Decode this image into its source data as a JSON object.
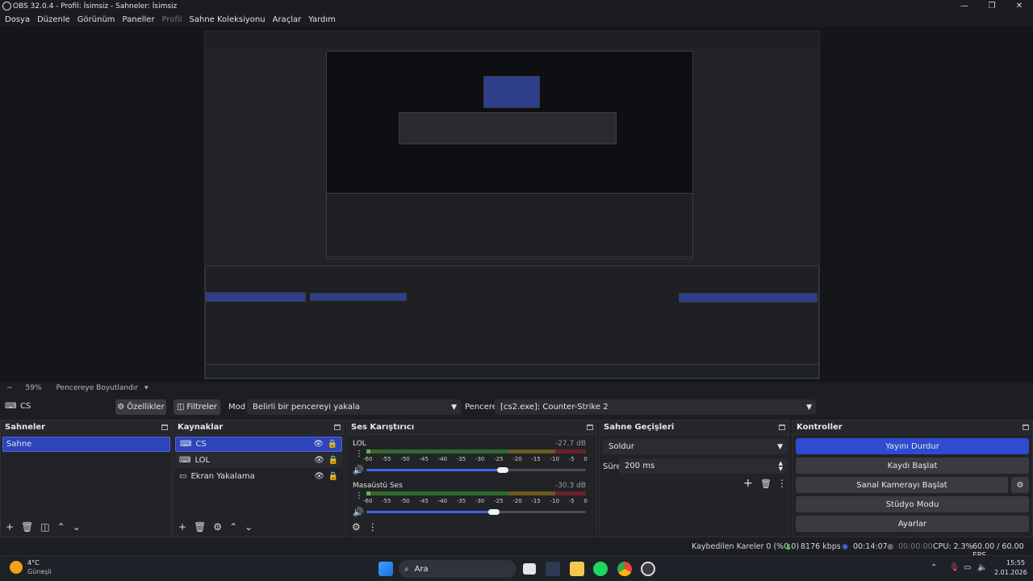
{
  "window": {
    "title": "OBS 32.0.4 - Profil: İsimsiz - Sahneler: İsimsiz",
    "controls": [
      "—",
      "❐",
      "✕"
    ]
  },
  "menu": [
    "Dosya",
    "Düzenle",
    "Görünüm",
    "Paneller",
    "Profil",
    "Sahne Koleksiyonu",
    "Araçlar",
    "Yardım"
  ],
  "zoom": {
    "minus": "−",
    "percent": "59%",
    "fit_label": "Pencereye Boyutlandır"
  },
  "source_toolbar": {
    "source_name": "CS",
    "properties": "Özellikler",
    "filters": "Filtreler",
    "mode_label": "Mod",
    "mode_value": "Belirli bir pencereyi yakala",
    "window_label": "Pencere",
    "window_value": "[cs2.exe]: Counter-Strike 2"
  },
  "scenes": {
    "title": "Sahneler",
    "items": [
      "Sahne"
    ]
  },
  "sources": {
    "title": "Kaynaklar",
    "items": [
      "CS",
      "LOL",
      "Ekran Yakalama"
    ]
  },
  "mixer": {
    "title": "Ses Karıştırıcı",
    "ticks": [
      "-60",
      "-55",
      "-50",
      "-45",
      "-40",
      "-35",
      "-30",
      "-25",
      "-20",
      "-15",
      "-10",
      "-5",
      "0"
    ],
    "channels": [
      {
        "name": "LOL",
        "db": "-27.7 dB",
        "level": 0.62
      },
      {
        "name": "Masaüstü Ses",
        "db": "-30.3 dB",
        "level": 0.58
      }
    ]
  },
  "transitions": {
    "title": "Sahne Geçişleri",
    "type": "Soldur",
    "duration_label": "Süre",
    "duration_value": "200 ms"
  },
  "controls": {
    "title": "Kontroller",
    "stop_stream": "Yayını Durdur",
    "start_record": "Kaydı Başlat",
    "virtual_cam": "Sanal Kamerayı Başlat",
    "studio_mode": "Stüdyo Modu",
    "settings": "Ayarlar"
  },
  "status": {
    "dropped": "Kaybedilen Kareler 0 (%0.0)",
    "bitrate": "8176 kbps",
    "stream_time": "00:14:07",
    "record_time": "00:00:00",
    "cpu": "CPU: 2.3%",
    "fps": "60.00 / 60.00 FPS"
  },
  "taskbar": {
    "weather_temp": "4°C",
    "weather_desc": "Güneşli",
    "search": "Ara",
    "time": "15:55",
    "date": "2.01.2026"
  },
  "colors": {
    "accent": "#2f4bd0",
    "selected": "#2d45b8"
  }
}
